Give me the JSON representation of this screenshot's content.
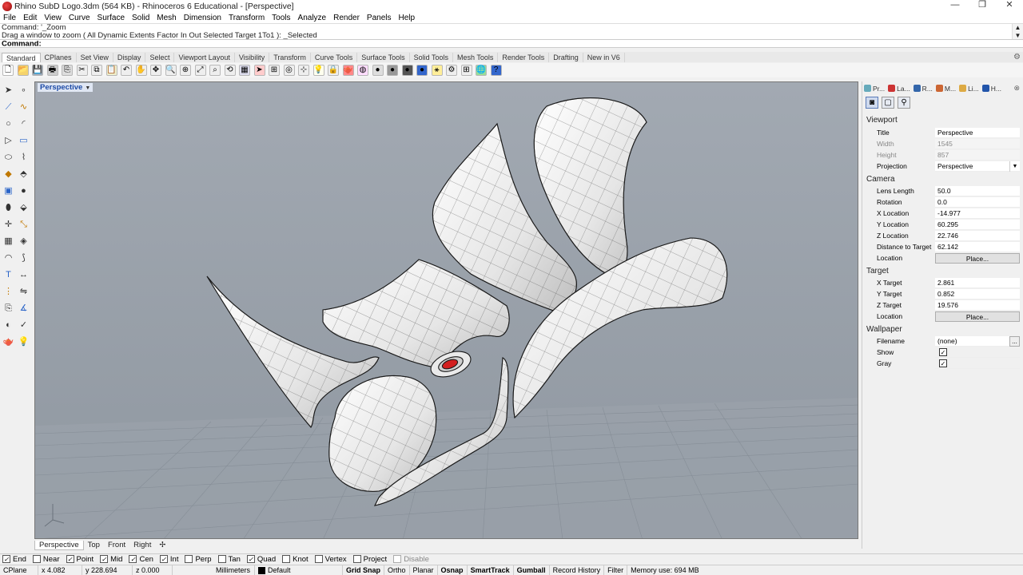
{
  "window": {
    "title": "Rhino SubD Logo.3dm (564 KB) - Rhinoceros 6 Educational - [Perspective]",
    "min_glyph": "—",
    "max_glyph": "❐",
    "close_glyph": "✕"
  },
  "menu": [
    "File",
    "Edit",
    "View",
    "Curve",
    "Surface",
    "Solid",
    "Mesh",
    "Dimension",
    "Transform",
    "Tools",
    "Analyze",
    "Render",
    "Panels",
    "Help"
  ],
  "command_history": [
    "Command: '_Zoom",
    "Drag a window to zoom ( All  Dynamic  Extents  Factor  In  Out  Selected  Target  1To1 ): _Selected"
  ],
  "command": {
    "label": "Command:",
    "value": ""
  },
  "toolbar_tabs": [
    "Standard",
    "CPlanes",
    "Set View",
    "Display",
    "Select",
    "Viewport Layout",
    "Visibility",
    "Transform",
    "Curve Tools",
    "Surface Tools",
    "Solid Tools",
    "Mesh Tools",
    "Render Tools",
    "Drafting",
    "New in V6"
  ],
  "active_toolbar_tab": "Standard",
  "toolbar_icons": [
    {
      "name": "new-icon",
      "glyph": "🗋",
      "color": "#ffffff"
    },
    {
      "name": "open-icon",
      "glyph": "📂",
      "color": "#f5d36b"
    },
    {
      "name": "save-icon",
      "glyph": "💾",
      "color": "#9ab"
    },
    {
      "name": "print-icon",
      "glyph": "🖶",
      "color": "#ccc"
    },
    {
      "name": "import-icon",
      "glyph": "⎘",
      "color": "#ddd"
    },
    {
      "name": "cut-icon",
      "glyph": "✂",
      "color": "#eee"
    },
    {
      "name": "copy-icon",
      "glyph": "⧉",
      "color": "#eee"
    },
    {
      "name": "paste-icon",
      "glyph": "📋",
      "color": "#eec"
    },
    {
      "name": "undo-icon",
      "glyph": "↶",
      "color": "#eee"
    },
    {
      "name": "pan-icon",
      "glyph": "✋",
      "color": "#eee"
    },
    {
      "name": "rotate-view-icon",
      "glyph": "✥",
      "color": "#eee"
    },
    {
      "name": "zoom-dynamic-icon",
      "glyph": "🔍",
      "color": "#eee"
    },
    {
      "name": "zoom-window-icon",
      "glyph": "⊕",
      "color": "#eee"
    },
    {
      "name": "zoom-extents-icon",
      "glyph": "⤢",
      "color": "#eee"
    },
    {
      "name": "zoom-selected-icon",
      "glyph": "⌕",
      "color": "#eee"
    },
    {
      "name": "undo-view-icon",
      "glyph": "⟲",
      "color": "#eee"
    },
    {
      "name": "four-view-icon",
      "glyph": "▦",
      "color": "#dde"
    },
    {
      "name": "select-icon",
      "glyph": "➤",
      "color": "#fcc"
    },
    {
      "name": "grid-snap-icon",
      "glyph": "⊞",
      "color": "#eee"
    },
    {
      "name": "cplane-icon",
      "glyph": "◎",
      "color": "#eee"
    },
    {
      "name": "osnap-icon",
      "glyph": "⊹",
      "color": "#eee"
    },
    {
      "name": "light-icon",
      "glyph": "💡",
      "color": "#ffe"
    },
    {
      "name": "lock-icon",
      "glyph": "🔒",
      "color": "#eee"
    },
    {
      "name": "render-icon",
      "glyph": "🫖",
      "color": "#f88"
    },
    {
      "name": "color-wheel-icon",
      "glyph": "◍",
      "color": "#fdf"
    },
    {
      "name": "sphere-render-icon",
      "glyph": "●",
      "color": "#ddd"
    },
    {
      "name": "sphere-dark-icon",
      "glyph": "●",
      "color": "#999"
    },
    {
      "name": "sphere-shade-icon",
      "glyph": "●",
      "color": "#555"
    },
    {
      "name": "sphere-blue-icon",
      "glyph": "●",
      "color": "#36c"
    },
    {
      "name": "gumball-icon",
      "glyph": "⚹",
      "color": "#fe9"
    },
    {
      "name": "settings-icon",
      "glyph": "⚙",
      "color": "#eee"
    },
    {
      "name": "grid-icon",
      "glyph": "⊞",
      "color": "#eee"
    },
    {
      "name": "globe-icon",
      "glyph": "🌐",
      "color": "#9d9"
    },
    {
      "name": "help-icon",
      "glyph": "?",
      "color": "#36c"
    }
  ],
  "viewport": {
    "label": "Perspective",
    "dropdown_glyph": "▼"
  },
  "view_tabs": [
    "Perspective",
    "Top",
    "Front",
    "Right"
  ],
  "add_view_glyph": "✢",
  "active_view": "Perspective",
  "panel": {
    "tabs": [
      {
        "label": "Pr...",
        "color": "#6ab"
      },
      {
        "label": "La...",
        "color": "#c33"
      },
      {
        "label": "R...",
        "color": "#36a"
      },
      {
        "label": "M...",
        "color": "#c63"
      },
      {
        "label": "Li...",
        "color": "#da4"
      },
      {
        "label": "H...",
        "color": "#25a"
      }
    ],
    "close_glyph": "⊗",
    "icons": [
      "camera-icon",
      "frame-icon",
      "object-properties-icon"
    ],
    "viewport_section": "Viewport",
    "viewport_rows": [
      {
        "k": "Title",
        "v": "Perspective"
      },
      {
        "k": "Width",
        "v": "1545",
        "disabled": true
      },
      {
        "k": "Height",
        "v": "857",
        "disabled": true
      },
      {
        "k": "Projection",
        "v": "Perspective",
        "dropdown": true
      }
    ],
    "camera_section": "Camera",
    "camera_rows": [
      {
        "k": "Lens Length",
        "v": "50.0"
      },
      {
        "k": "Rotation",
        "v": "0.0"
      },
      {
        "k": "X Location",
        "v": "-14.977"
      },
      {
        "k": "Y Location",
        "v": "60.295"
      },
      {
        "k": "Z Location",
        "v": "22.746"
      },
      {
        "k": "Distance to Target",
        "v": "62.142"
      },
      {
        "k": "Location",
        "v": "Place...",
        "button": true
      }
    ],
    "target_section": "Target",
    "target_rows": [
      {
        "k": "X Target",
        "v": "2.861"
      },
      {
        "k": "Y Target",
        "v": "0.852"
      },
      {
        "k": "Z Target",
        "v": "19.576"
      },
      {
        "k": "Location",
        "v": "Place...",
        "button": true
      }
    ],
    "wallpaper_section": "Wallpaper",
    "wallpaper_rows": [
      {
        "k": "Filename",
        "v": "(none)",
        "ellipsis": true
      },
      {
        "k": "Show",
        "check": true
      },
      {
        "k": "Gray",
        "check": true
      }
    ],
    "dropdown_glyph": "▼",
    "ellipsis_glyph": "...",
    "check_glyph": "✓"
  },
  "osnaps": [
    {
      "label": "End",
      "checked": true
    },
    {
      "label": "Near",
      "checked": false
    },
    {
      "label": "Point",
      "checked": true
    },
    {
      "label": "Mid",
      "checked": true
    },
    {
      "label": "Cen",
      "checked": true
    },
    {
      "label": "Int",
      "checked": true
    },
    {
      "label": "Perp",
      "checked": false
    },
    {
      "label": "Tan",
      "checked": false
    },
    {
      "label": "Quad",
      "checked": true
    },
    {
      "label": "Knot",
      "checked": false
    },
    {
      "label": "Vertex",
      "checked": false
    },
    {
      "label": "Project",
      "checked": false
    },
    {
      "label": "Disable",
      "checked": false,
      "disabled": true
    }
  ],
  "osnap_check_glyph": "✓",
  "status": {
    "cplane": "CPlane",
    "x": "x 4.082",
    "y": "y 228.694",
    "z": "z 0.000",
    "units": "Millimeters",
    "layer": "Default",
    "grid_snap": "Grid Snap",
    "ortho": "Ortho",
    "planar": "Planar",
    "osnap": "Osnap",
    "smarttrack": "SmartTrack",
    "gumball": "Gumball",
    "record_history": "Record History",
    "filter": "Filter",
    "memory": "Memory use: 694 MB"
  },
  "colors": {
    "viewport_bg": "#9aa2ab",
    "active_label": "#1c4aa6",
    "accent_red": "#d21f1f"
  }
}
